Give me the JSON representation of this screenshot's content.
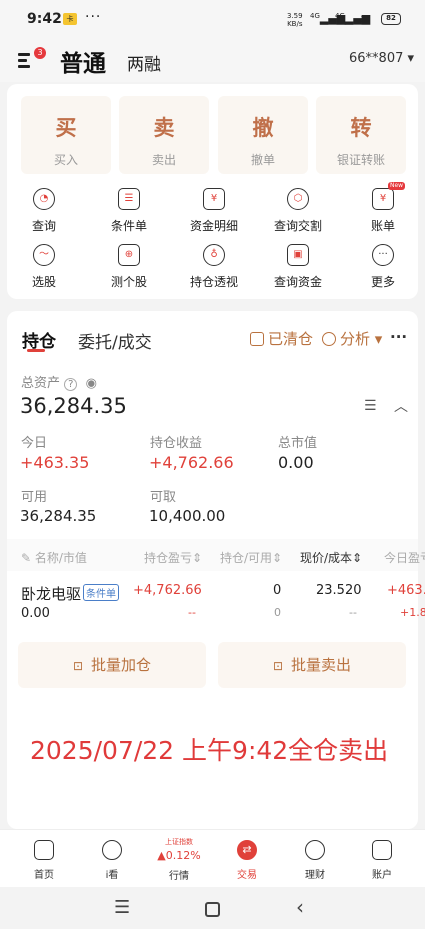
{
  "status_bar": {
    "time": "9:42",
    "sim": "卡",
    "dots": "···",
    "net_speed": "3.59",
    "net_unit": "KB/s",
    "sig1": "4G",
    "sig2": "4G",
    "battery": "82"
  },
  "header": {
    "badge": "3",
    "title": "普通",
    "subtitle": "两融",
    "account": "66**807 ▾"
  },
  "trade_buttons": [
    {
      "title": "买",
      "sub": "买入"
    },
    {
      "title": "卖",
      "sub": "卖出"
    },
    {
      "title": "撤",
      "sub": "撤单"
    },
    {
      "title": "转",
      "sub": "银证转账"
    }
  ],
  "functions": [
    {
      "label": "查询",
      "icon": "search-icon"
    },
    {
      "label": "条件单",
      "icon": "condition-order-icon"
    },
    {
      "label": "资金明细",
      "icon": "fund-detail-icon"
    },
    {
      "label": "查询交割",
      "icon": "delivery-query-icon"
    },
    {
      "label": "账单",
      "icon": "bill-icon",
      "tag": "New"
    },
    {
      "label": "选股",
      "icon": "stock-picker-icon"
    },
    {
      "label": "测个股",
      "icon": "stock-test-icon"
    },
    {
      "label": "持仓透视",
      "icon": "position-view-icon"
    },
    {
      "label": "查询资金",
      "icon": "fund-query-icon"
    },
    {
      "label": "更多",
      "icon": "more-icon"
    }
  ],
  "tabs": {
    "positions": "持仓",
    "orders": "委托/成交"
  },
  "tools": {
    "cleared": "已清仓",
    "analysis": "分析 ▾",
    "more": "···"
  },
  "summary": {
    "total_assets_label": "总资产",
    "total_assets": "36,284.35",
    "today_label": "今日",
    "today": "+463.35",
    "position_gain_label": "持仓收益",
    "position_gain": "+4,762.66",
    "market_value_label": "总市值",
    "market_value": "0.00",
    "available_label": "可用",
    "available": "36,284.35",
    "withdrawable_label": "可取",
    "withdrawable": "10,400.00"
  },
  "table": {
    "headers": [
      "名称/市值",
      "持仓盈亏",
      "持仓/可用",
      "现价/成本",
      "今日盈亏"
    ],
    "row": {
      "name": "卧龙电驱",
      "tag": "条件单",
      "market_value": "0.00",
      "pnl": "+4,762.66",
      "pnl2": "--",
      "qty": "0",
      "avail": "0",
      "price": "23.520",
      "cost": "--",
      "today": "+463.",
      "today2": "+1.8"
    }
  },
  "actions": {
    "add": "批量加仓",
    "sell": "批量卖出"
  },
  "note": "2025/07/22 上午9:42全仓卖出",
  "bottom_nav": [
    {
      "label": "首页"
    },
    {
      "label": "i看"
    },
    {
      "label": "行情",
      "index_name": "上证指数",
      "index_change": "▲0.12%"
    },
    {
      "label": "交易"
    },
    {
      "label": "理财"
    },
    {
      "label": "账户"
    }
  ],
  "colors": {
    "accent": "#e0413a",
    "gold": "#b9723f"
  }
}
